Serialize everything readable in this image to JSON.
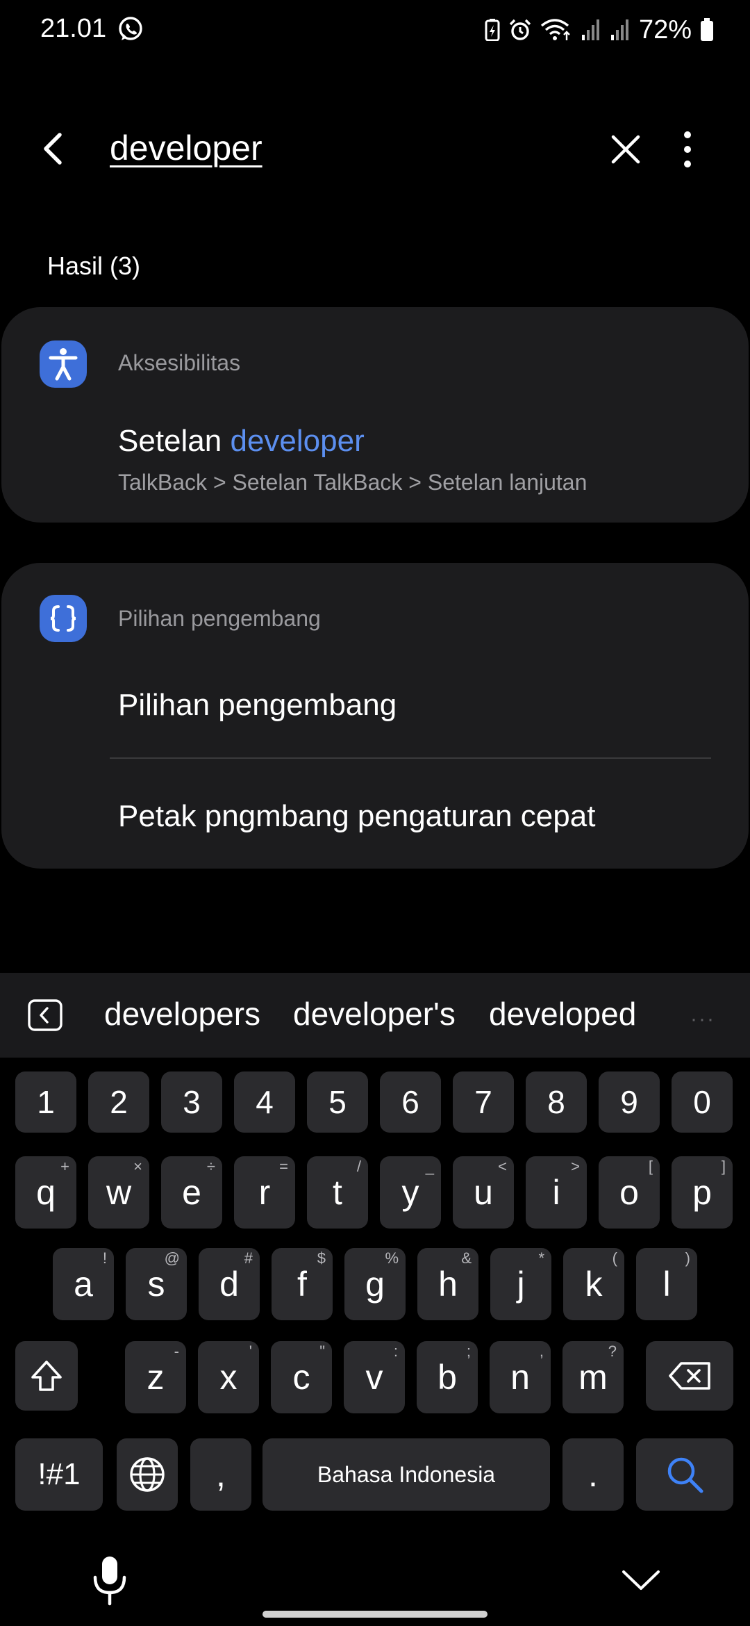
{
  "status_bar": {
    "time": "21.01",
    "battery": "72%",
    "icons": [
      "whatsapp-icon",
      "battery-saver-icon",
      "alarm-icon",
      "wifi-icon",
      "signal-icon",
      "signal-icon",
      "battery-icon"
    ]
  },
  "search": {
    "query": "developer",
    "back_icon": "back-arrow-icon",
    "clear_icon": "close-icon",
    "more_icon": "more-vert-icon"
  },
  "results_label": "Hasil (3)",
  "groups": [
    {
      "category": "Aksesibilitas",
      "icon": "accessibility-icon",
      "items": [
        {
          "title_prefix": "Setelan ",
          "title_highlight": "developer",
          "path": "TalkBack > Setelan TalkBack > Setelan lanjutan"
        }
      ]
    },
    {
      "category": "Pilihan pengembang",
      "icon": "developer-options-icon",
      "items": [
        {
          "title": "Pilihan pengembang"
        },
        {
          "title": "Petak pngmbang pengaturan cepat"
        }
      ]
    }
  ],
  "keyboard": {
    "suggestions": [
      "developers",
      "developer's",
      "developed"
    ],
    "more": "···",
    "number_row": [
      "1",
      "2",
      "3",
      "4",
      "5",
      "6",
      "7",
      "8",
      "9",
      "0"
    ],
    "row1": [
      {
        "key": "q",
        "hint": "+"
      },
      {
        "key": "w",
        "hint": "×"
      },
      {
        "key": "e",
        "hint": "÷"
      },
      {
        "key": "r",
        "hint": "="
      },
      {
        "key": "t",
        "hint": "/"
      },
      {
        "key": "y",
        "hint": "_"
      },
      {
        "key": "u",
        "hint": "<"
      },
      {
        "key": "i",
        "hint": ">"
      },
      {
        "key": "o",
        "hint": "["
      },
      {
        "key": "p",
        "hint": "]"
      }
    ],
    "row2": [
      {
        "key": "a",
        "hint": "!"
      },
      {
        "key": "s",
        "hint": "@"
      },
      {
        "key": "d",
        "hint": "#"
      },
      {
        "key": "f",
        "hint": "$"
      },
      {
        "key": "g",
        "hint": "%"
      },
      {
        "key": "h",
        "hint": "&"
      },
      {
        "key": "j",
        "hint": "*"
      },
      {
        "key": "k",
        "hint": "("
      },
      {
        "key": "l",
        "hint": ")"
      }
    ],
    "row3": [
      {
        "key": "z",
        "hint": "-"
      },
      {
        "key": "x",
        "hint": "'"
      },
      {
        "key": "c",
        "hint": "\""
      },
      {
        "key": "v",
        "hint": ":"
      },
      {
        "key": "b",
        "hint": ";"
      },
      {
        "key": "n",
        "hint": ","
      },
      {
        "key": "m",
        "hint": "?"
      }
    ],
    "symbols_key": "!#1",
    "comma_key": ",",
    "space_label": "Bahasa Indonesia",
    "period_key": ".",
    "accent_color": "#3e82f7"
  }
}
